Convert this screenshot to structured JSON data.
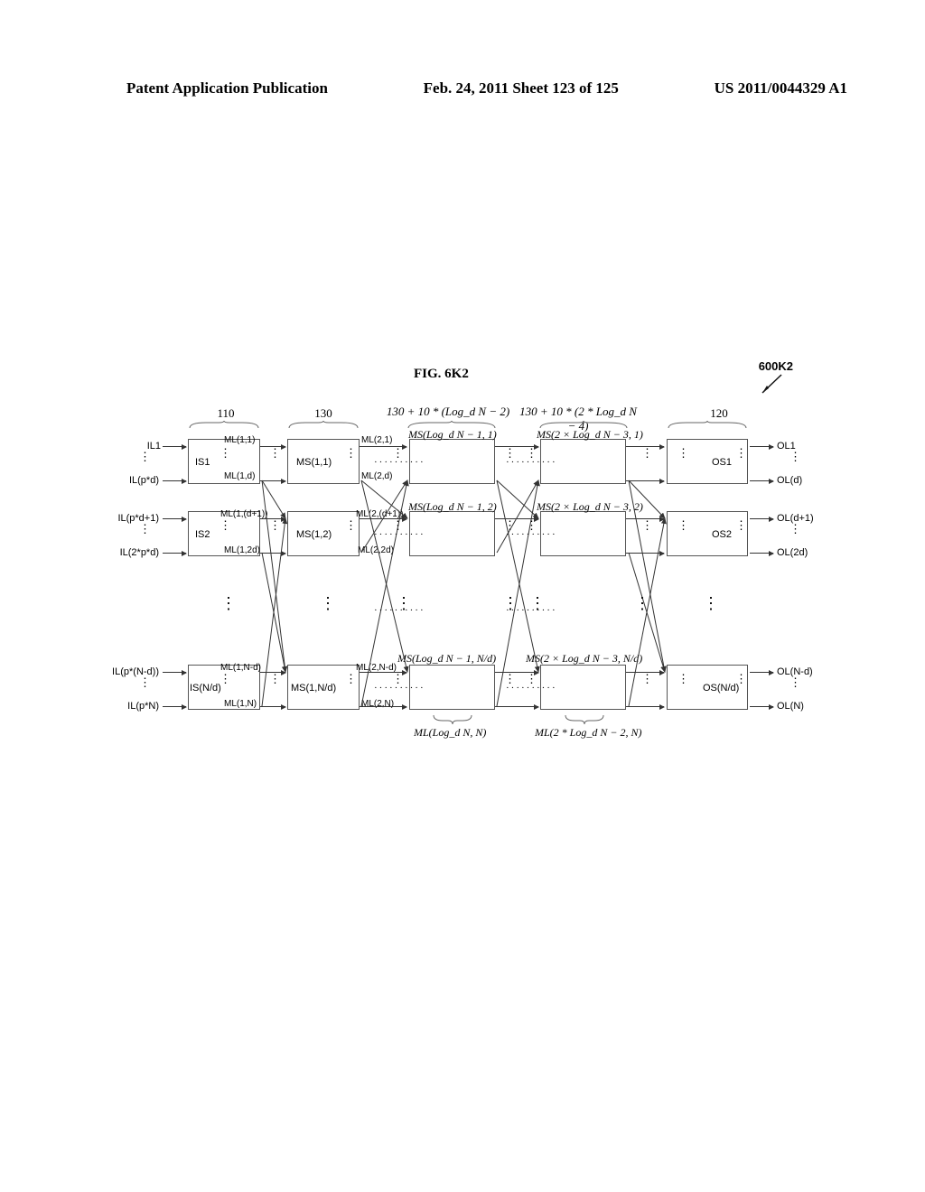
{
  "header": {
    "left": "Patent Application Publication",
    "middle": "Feb. 24, 2011  Sheet 123 of 125",
    "right": "US 2011/0044329 A1"
  },
  "figure": {
    "title": "FIG. 6K2",
    "number": "600K2"
  },
  "columns": {
    "c1": "110",
    "c2": "130",
    "c3": "130 + 10 * (Log_d N − 2)",
    "c4": "130 + 10 * (2 * Log_d N − 4)",
    "c5": "120"
  },
  "rows": {
    "in": {
      "r1a": "IL1",
      "r1b": "IL(p*d)",
      "r2a": "IL(p*d+1)",
      "r2b": "IL(2*p*d)",
      "r3a": "IL(p*(N-d))",
      "r3b": "IL(p*N)"
    },
    "out": {
      "r1a": "OL1",
      "r1b": "OL(d)",
      "r2a": "OL(d+1)",
      "r2b": "OL(2d)",
      "r3a": "OL(N-d)",
      "r3b": "OL(N)"
    },
    "is": {
      "r1": "IS1",
      "r2": "IS2",
      "r3": "IS(N/d)"
    },
    "os": {
      "r1": "OS1",
      "r2": "OS2",
      "r3": "OS(N/d)"
    }
  },
  "ml": {
    "r1_a": "ML(1,1)",
    "r1_b": "ML(1,d)",
    "r2_a": "ML(1,(d+1))",
    "r2_b": "ML(1,2d)",
    "r3_a": "ML(1,N-d)",
    "r3_b": "ML(1,N)",
    "s2r1_a": "ML(2,1)",
    "s2r1_b": "ML(2,d)",
    "s2r2_a": "ML(2,(d+1))",
    "s2r2_b": "ML(2,2d)",
    "s2r3_a": "ML(2,N-d)",
    "s2r3_b": "ML(2,N)",
    "mid_bottom": "ML(Log_d N, N)",
    "right_bottom": "ML(2 * Log_d N − 2, N)"
  },
  "ms": {
    "r1": "MS(1,1)",
    "r2": "MS(1,2)",
    "r3": "MS(1,N/d)",
    "mid_r1": "MS(Log_d N − 1, 1)",
    "mid_r2": "MS(Log_d N − 1, 2)",
    "mid_r3": "MS(Log_d N − 1, N/d)",
    "right_r1": "MS(2 × Log_d N − 3, 1)",
    "right_r2": "MS(2 × Log_d N − 3, 2)",
    "right_r3": "MS(2 × Log_d N − 3, N/d)"
  }
}
